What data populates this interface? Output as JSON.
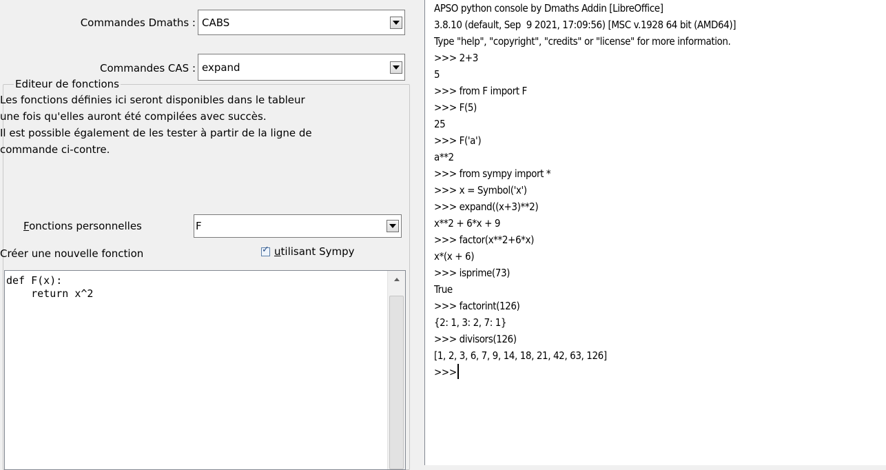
{
  "dmaths": {
    "label": "Commandes Dmaths :",
    "value": "CABS"
  },
  "cas": {
    "label": "Commandes CAS :",
    "value": "expand"
  },
  "editor_group": {
    "legend": "Editeur de fonctions",
    "description": [
      "Les fonctions définies ici seront disponibles dans le tableur",
      "une fois qu'elles auront été compilées avec succès.",
      "Il est possible également de les tester à partir de la ligne de",
      "commande ci-contre."
    ],
    "personal_label_mnemonic": "F",
    "personal_label_rest": "onctions personnelles",
    "personal_value": "F",
    "new_function_label": "Créer une nouvelle fonction",
    "sympy_checked": true,
    "sympy_label_mnemonic": "u",
    "sympy_label_rest": "tilisant Sympy",
    "code": "def F(x):\n    return x^2"
  },
  "console": {
    "lines": [
      "APSO python console by Dmaths Addin [LibreOffice]",
      "3.8.10 (default, Sep  9 2021, 17:09:56) [MSC v.1928 64 bit (AMD64)]",
      "Type \"help\", \"copyright\", \"credits\" or \"license\" for more information.",
      ">>> 2+3",
      "5",
      ">>> from F import F",
      ">>> F(5)",
      "25",
      ">>> F('a')",
      "a**2",
      ">>> from sympy import *",
      ">>> x = Symbol('x')",
      ">>> expand((x+3)**2)",
      "x**2 + 6*x + 9",
      ">>> factor(x**2+6*x)",
      "x*(x + 6)",
      ">>> isprime(73)",
      "True",
      ">>> factorint(126)",
      "{2: 1, 3: 2, 7: 1}",
      ">>> divisors(126)",
      "[1, 2, 3, 6, 7, 9, 14, 18, 21, 42, 63, 126]"
    ],
    "prompt": ">>>"
  }
}
